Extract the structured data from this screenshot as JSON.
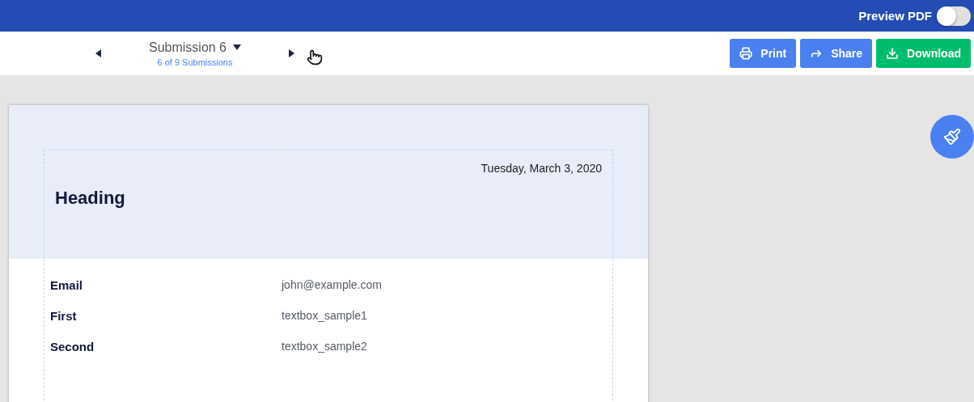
{
  "top_bar": {
    "preview_pdf": {
      "label": "Preview PDF",
      "on": false
    }
  },
  "toolbar": {
    "submission_title": "Submission 6",
    "submission_count": "6 of 9 Submissions",
    "buttons": [
      {
        "kind": "print",
        "label": "Print"
      },
      {
        "kind": "share",
        "label": "Share"
      },
      {
        "kind": "download",
        "label": "Download"
      }
    ]
  },
  "document": {
    "date": "Tuesday, March 3, 2020",
    "heading": "Heading",
    "fields": [
      {
        "label": "Email",
        "value": "john@example.com"
      },
      {
        "label": "First",
        "value": "textbox_sample1"
      },
      {
        "label": "Second",
        "value": "textbox_sample2"
      }
    ]
  }
}
